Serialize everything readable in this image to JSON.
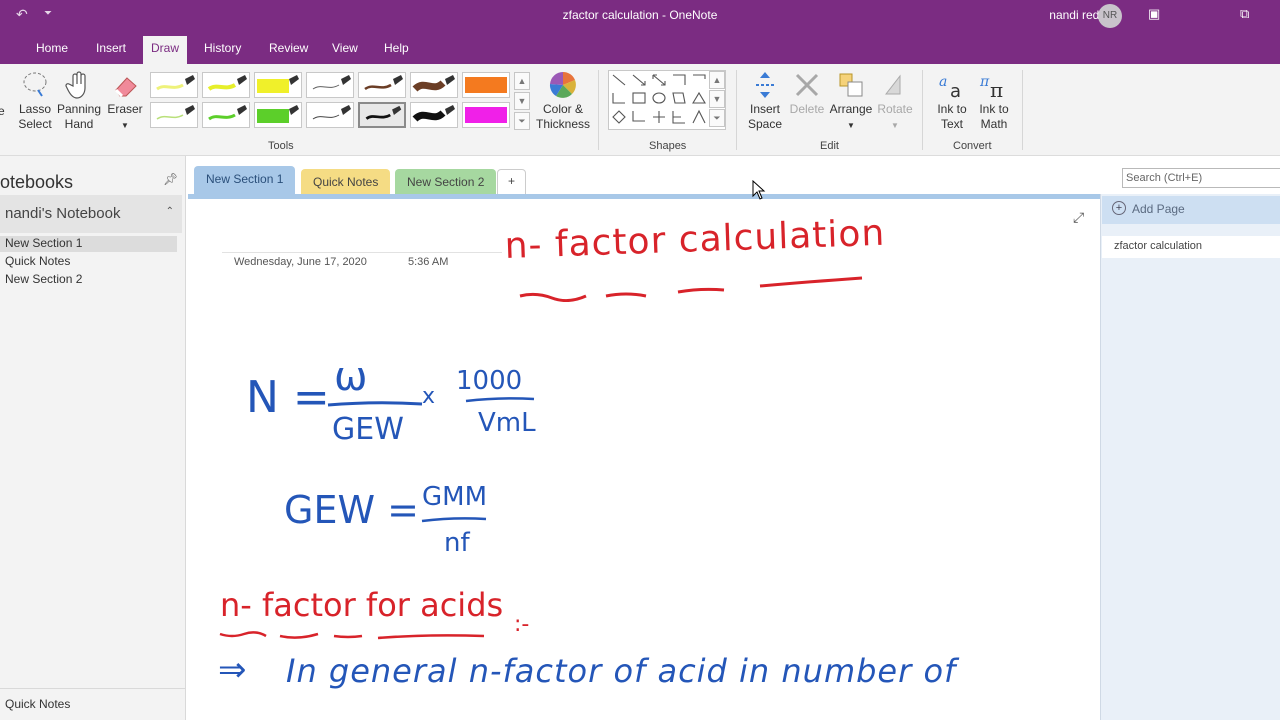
{
  "window": {
    "title": "zfactor calculation  -  OneNote",
    "user_name": "nandi reddy",
    "user_initials": "NR",
    "qat_undo": "↶",
    "qat_redo": "↷",
    "qat_customize": "⏷",
    "winbtn_ribbon_options": "▣",
    "winbtn_restore": "⧉"
  },
  "menu": {
    "home": "Home",
    "insert": "Insert",
    "draw": "Draw",
    "history": "History",
    "review": "Review",
    "view": "View",
    "help": "Help"
  },
  "ribbon": {
    "tools": {
      "partial_label": "e",
      "lasso_select": [
        "Lasso",
        "Select"
      ],
      "panning_hand": [
        "Panning",
        "Hand"
      ],
      "eraser": "Eraser",
      "color_thickness": [
        "Color &",
        "Thickness"
      ],
      "group_label": "Tools"
    },
    "pens": [
      {
        "color": "#eef27a",
        "style": "highlighter"
      },
      {
        "color": "#e6ef2a",
        "style": "highlighter"
      },
      {
        "color": "#f0f02a",
        "style": "highlighter-thick"
      },
      {
        "color": "#5f5f5f",
        "style": "thin"
      },
      {
        "color": "#6b3e26",
        "style": "medium"
      },
      {
        "color": "#6b3e26",
        "style": "thick"
      },
      {
        "color": "#f47a1f",
        "style": "highlighter-thick"
      },
      {
        "color": "#b9e07a",
        "style": "thin"
      },
      {
        "color": "#5ccf2a",
        "style": "medium"
      },
      {
        "color": "#5ccf2a",
        "style": "highlighter-thick"
      },
      {
        "color": "#444444",
        "style": "thin"
      },
      {
        "color": "#111111",
        "style": "medium",
        "selected": true
      },
      {
        "color": "#111111",
        "style": "thick"
      },
      {
        "color": "#f020e8",
        "style": "highlighter-thick"
      }
    ],
    "shapes": {
      "group_label": "Shapes"
    },
    "edit": {
      "insert_space": [
        "Insert",
        "Space"
      ],
      "delete": "Delete",
      "arrange": "Arrange",
      "rotate": "Rotate",
      "group_label": "Edit"
    },
    "convert": {
      "ink_to_text": [
        "Ink to",
        "Text"
      ],
      "ink_to_math": [
        "Ink to",
        "Math"
      ],
      "group_label": "Convert"
    }
  },
  "notebooks_pane": {
    "header": "otebooks",
    "notebook_name": "nandi's Notebook",
    "sections": [
      "New Section 1",
      "Quick Notes",
      "New Section 2"
    ],
    "footer": "Quick Notes"
  },
  "section_tabs": [
    {
      "label": "New Section 1",
      "color": "#a8c8e8"
    },
    {
      "label": "Quick Notes",
      "color": "#f5dc84"
    },
    {
      "label": "New Section 2",
      "color": "#a6d8a0"
    }
  ],
  "add_section_symbol": "+",
  "search": {
    "placeholder": "Search (Ctrl+E)"
  },
  "pages_pane": {
    "add_page": "Add Page",
    "pages": [
      "zfactor calculation"
    ]
  },
  "page": {
    "date": "Wednesday, June 17, 2020",
    "time": "5:36 AM",
    "ink": {
      "title": "n- factor calculation",
      "formula_lhs": "N =",
      "formula_num": "ω",
      "formula_den": "GEW",
      "formula_times": "x",
      "formula_num2": "1000",
      "formula_den2": "VmL",
      "gew_lhs": "GEW =",
      "gew_num": "GMM",
      "gew_den": "nf",
      "heading": "n- factor for acids",
      "heading_suffix": ":-",
      "arrow": "⇒",
      "line1": "In general n-factor of acid in number of"
    }
  }
}
